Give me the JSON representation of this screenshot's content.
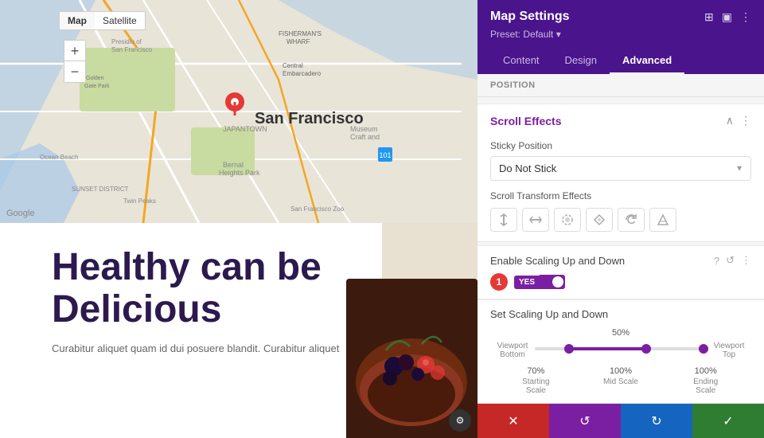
{
  "panel": {
    "title": "Map Settings",
    "preset": "Preset: Default ▾",
    "tabs": [
      {
        "label": "Content",
        "active": false
      },
      {
        "label": "Design",
        "active": false
      },
      {
        "label": "Advanced",
        "active": true
      }
    ],
    "position_label": "POSITION",
    "scroll_effects": {
      "title": "Scroll Effects",
      "sticky_position": {
        "label": "Sticky Position",
        "value": "Do Not Stick"
      },
      "scroll_transform": {
        "label": "Scroll Transform Effects",
        "icons": [
          "vertical-motion",
          "horizontal-motion",
          "fade",
          "blur",
          "rotate",
          "opacity"
        ]
      }
    },
    "enable_scaling": {
      "label": "Enable Scaling Up and Down",
      "enabled": true,
      "toggle_label": "YES"
    },
    "set_scaling": {
      "title": "Set Scaling Up and Down",
      "midpoint_pct": "50%",
      "viewport_bottom": "Viewport\nBottom",
      "viewport_top": "Viewport\nTop",
      "starting_scale_pct": "70%",
      "starting_scale_label": "Starting\nScale",
      "mid_scale_pct": "100%",
      "mid_scale_label": "Mid Scale",
      "ending_scale_pct": "100%",
      "ending_scale_label": "Ending\nScale"
    },
    "footer": {
      "cancel": "✕",
      "undo": "↺",
      "redo": "↻",
      "save": "✓"
    }
  },
  "map": {
    "type_buttons": [
      "Map",
      "Satellite"
    ],
    "active_type": "Map",
    "city_label": "San Francisco",
    "google_label": "Google"
  },
  "content": {
    "title": "Healthy can be\nDelicious",
    "body": "Curabitur aliquet quam id dui posuere blandit. Curabitur aliquet"
  },
  "badge": {
    "value": "1"
  }
}
